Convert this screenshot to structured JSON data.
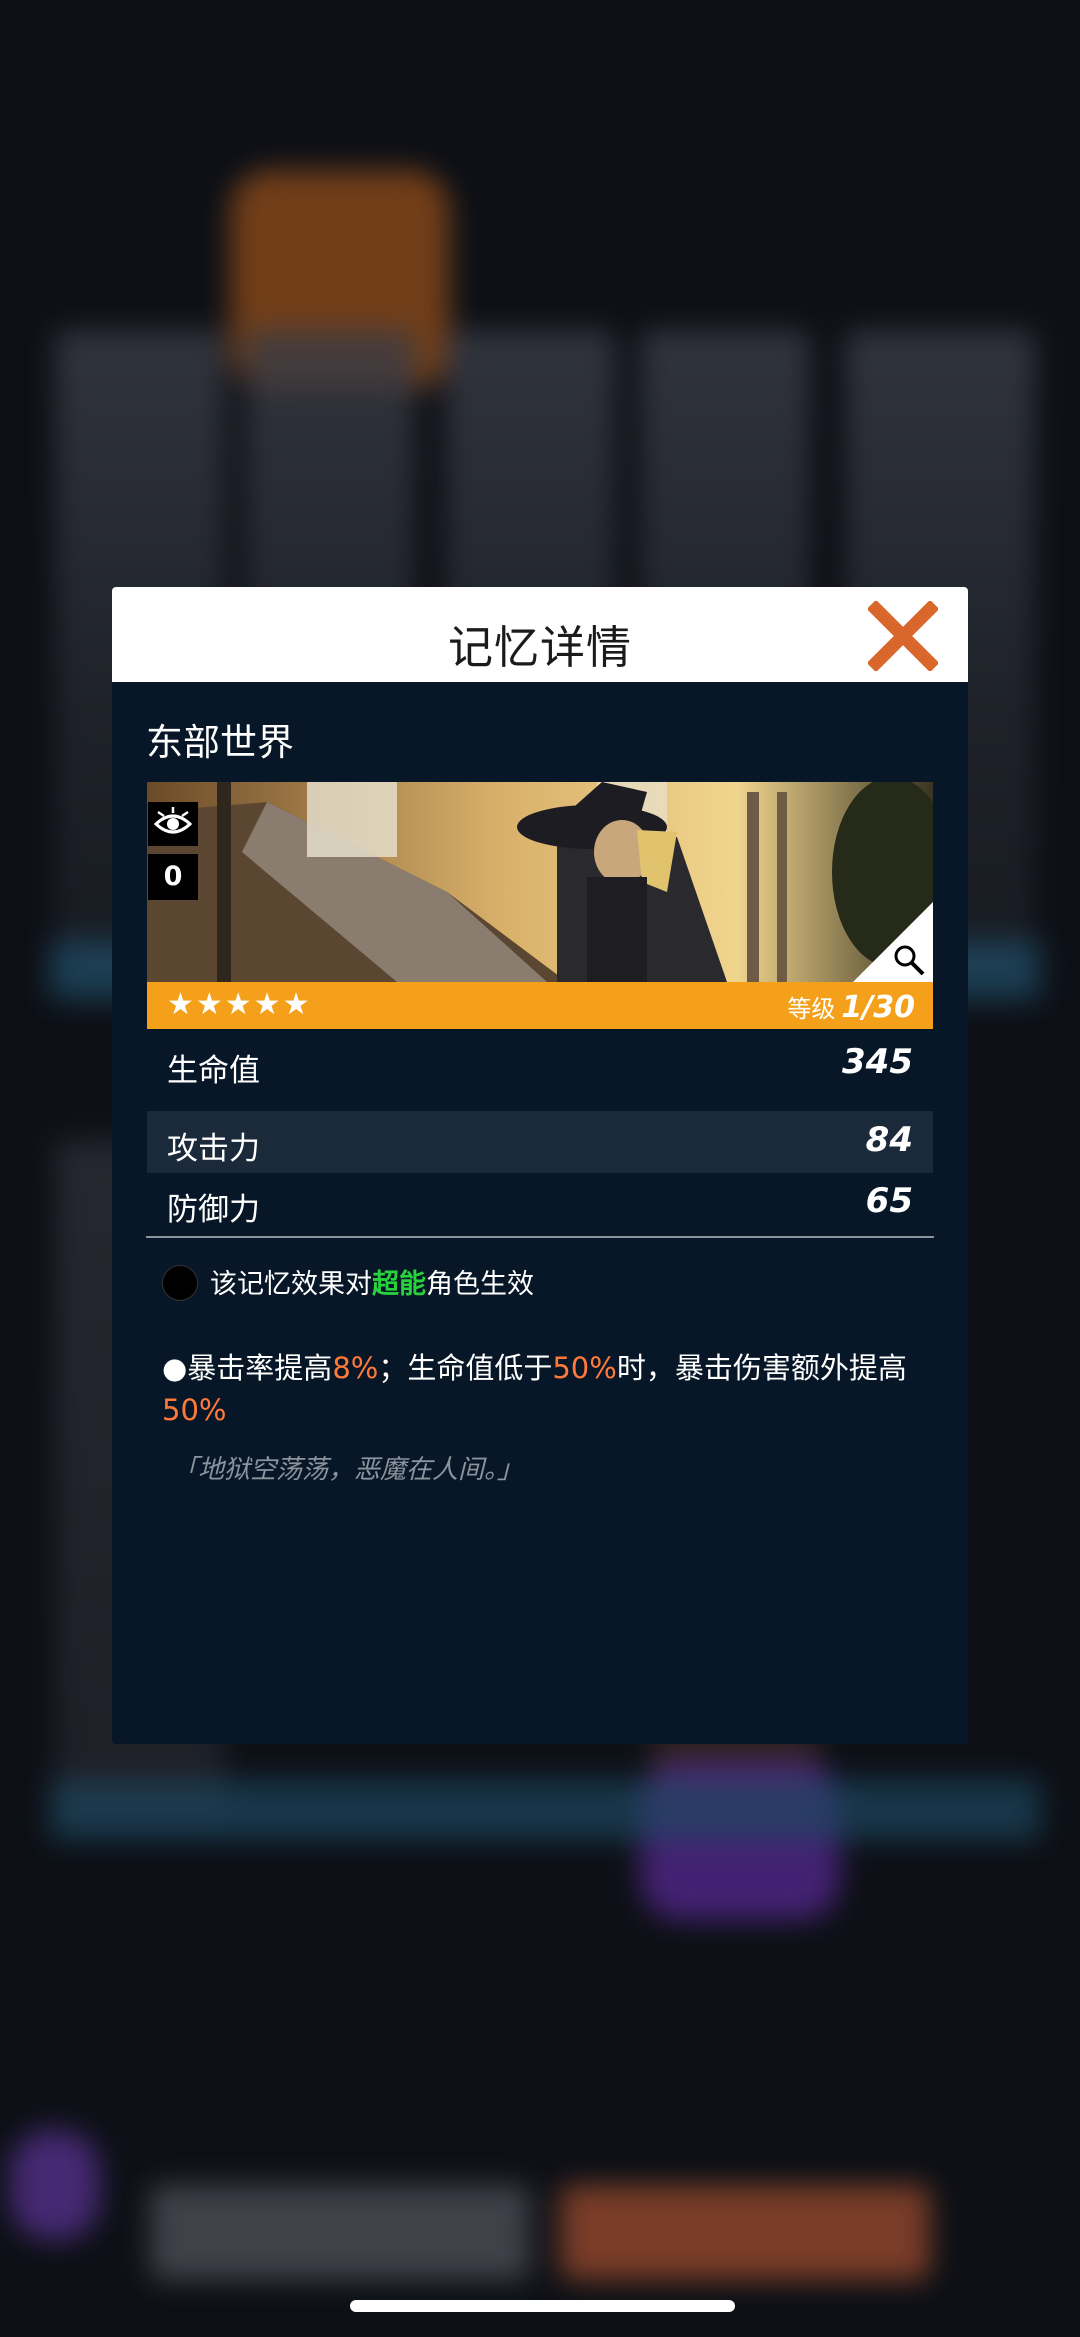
{
  "modal": {
    "title": "记忆详情",
    "memory_name": "东部世界",
    "badge_count": "0",
    "rating_stars": "★★★★★",
    "level_label": "等级",
    "level_value": "1/30",
    "close_icon": "close-x-icon",
    "zoom_icon": "magnifier-icon",
    "accent_color": "#f5a01a",
    "close_color": "#d9662a"
  },
  "stats": [
    {
      "label": "生命值",
      "value": "345"
    },
    {
      "label": "攻击力",
      "value": "84"
    },
    {
      "label": "防御力",
      "value": "65"
    }
  ],
  "role_note": {
    "before": "该记忆效果对",
    "highlight": "超能",
    "after": "角色生效"
  },
  "effect": {
    "p1": "●暴击率提高",
    "v1": "8%",
    "p2": "；生命值低于",
    "v2": "50%",
    "p3": "时，暴击伤害额外提高",
    "v3": "50%"
  },
  "quote": "「地狱空荡荡，恶魔在人间。」"
}
